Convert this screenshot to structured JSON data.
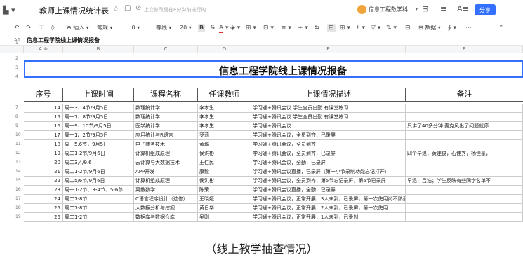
{
  "titlebar": {
    "doc_title": "教师上课情况统计表",
    "saved_status": "上次修改是在8分钟前进行的",
    "user_name": "信息工程数学科...",
    "share_label": "分享"
  },
  "toolbar": {
    "insert": "插入",
    "format": "常规",
    "decimals": ".0",
    "font": "等线",
    "size": "20",
    "bold": "B",
    "italic": "A",
    "sigma": "Σ",
    "data": "数据"
  },
  "formula_bar": {
    "cell_ref": "A1",
    "content": "信息工程学院线上课情况报备"
  },
  "columns": [
    "A",
    "B",
    "C",
    "D",
    "E",
    "F"
  ],
  "sheet": {
    "title": "信息工程学院线上课情况报备",
    "headers": [
      "序号",
      "上课时间",
      "课程名称",
      "任课教师",
      "上课情况描述",
      "备注"
    ],
    "row_numbers": [
      "1",
      "2",
      "3",
      "4",
      "7",
      "8",
      "9",
      "10",
      "11",
      "12",
      "13",
      "14",
      "15",
      "16",
      "17",
      "18",
      "19"
    ],
    "rows": [
      {
        "no": "14",
        "time": "周一3、4节/9月5日",
        "course": "数理统计学",
        "teacher": "李孝生",
        "desc": "学习通+腾讯会议 学生全员出勤 有课堂练习",
        "note": ""
      },
      {
        "no": "15",
        "time": "周一7、8节/9月5日",
        "course": "数理统计学",
        "teacher": "李孝生",
        "desc": "学习通+腾讯会议 学生全员出勤 有课堂练习",
        "note": ""
      },
      {
        "no": "16",
        "time": "周一9、10节/9月5日",
        "course": "医学统计学",
        "teacher": "李孝生",
        "desc": "学习通+腾讯会议",
        "note": "只讲了40多分钟 麦克风出了问题就停"
      },
      {
        "no": "17",
        "time": "周一1、2节/9月5日",
        "course": "应用统计与R语言",
        "teacher": "罗莉",
        "desc": "学习通+腾讯会议，全员到齐，已录屏",
        "note": ""
      },
      {
        "no": "18",
        "time": "周一5.6节，9月5日",
        "course": "电子商务技术",
        "teacher": "黄璐",
        "desc": "学习通+腾讯会议，全员到齐",
        "note": ""
      },
      {
        "no": "19",
        "time": "周二1-2节/9月6日",
        "course": "计算机组成原理",
        "teacher": "侯洪彬",
        "desc": "学习通+腾讯会议，全员到齐，已录屏",
        "note": "四个早退，黄连俊，石佳秀，杨佳豪，"
      },
      {
        "no": "20",
        "time": "周二3,4/9.6",
        "course": "云计算与大数据技术",
        "teacher": "王仁民",
        "desc": "学习通+腾讯会议，全勤，已录屏",
        "note": ""
      },
      {
        "no": "21",
        "time": "周二1-2节/9月6日",
        "course": "APP开发",
        "teacher": "康毅",
        "desc": "学习通+腾讯会议直播，已录屏（第一小节录制功能忘记打开）",
        "note": ""
      },
      {
        "no": "22",
        "time": "周二5/6节/9月6日",
        "course": "计算机组成原理",
        "teacher": "侯洪彬",
        "desc": "学习通+腾讯会议，全员到齐，第5节忘记录屏，第6节已录屏",
        "note": "早退：吕浩；学生反映有些同学名单不"
      },
      {
        "no": "23",
        "time": "周一1-2节、3-4节、5-6节",
        "course": "离散数学",
        "teacher": "陈荣",
        "desc": "学习通+腾讯会议直播，全勤，已录屏",
        "note": ""
      },
      {
        "no": "24",
        "time": "周二7-8节",
        "course": "C语言程序设计（选修）",
        "teacher": "王晓娅",
        "desc": "学习通+腾讯会议，正常开展，3人未到，已录屏，第一次使用尚不熟悉，多数同学未签到成功",
        "note": ""
      },
      {
        "no": "25",
        "time": "周二7-8节",
        "course": "大数据分析与挖掘",
        "teacher": "黄日华",
        "desc": "学习通+腾讯会议，正常开展，2人未到，已录屏，第一次使用",
        "note": ""
      },
      {
        "no": "26",
        "time": "周二1-2节",
        "course": "数据库与数据仓库",
        "teacher": "吴刚",
        "desc": "学习通+腾讯会议，正常开展，1人未到，已录制",
        "note": ""
      }
    ]
  },
  "caption": "（线上教学抽查情况）",
  "colors": {
    "accent": "#3370ff",
    "avatar": "#f1a33c"
  }
}
